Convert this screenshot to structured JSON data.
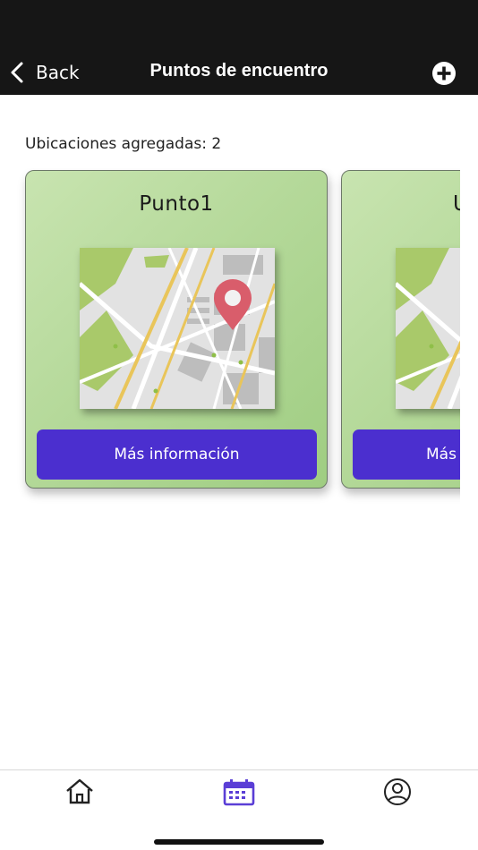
{
  "nav": {
    "back_label": "Back",
    "title": "Puntos de encuentro",
    "add_icon": "plus-circle-icon"
  },
  "summary": {
    "count_label": "Ubicaciones agregadas: 2"
  },
  "cards": [
    {
      "title": "Punto1",
      "button_label": "Más información",
      "image_icon": "map-pin-icon"
    },
    {
      "title": "U",
      "button_label": "Más",
      "image_icon": "map-pin-icon"
    }
  ],
  "tabs": [
    {
      "icon": "home-icon",
      "active": false
    },
    {
      "icon": "calendar-icon",
      "active": true
    },
    {
      "icon": "user-icon",
      "active": false
    }
  ],
  "colors": {
    "accent": "#4b2fcf",
    "header_bg": "#161616",
    "card_green": "#b5d99a",
    "tab_active": "#5a3ed6"
  }
}
